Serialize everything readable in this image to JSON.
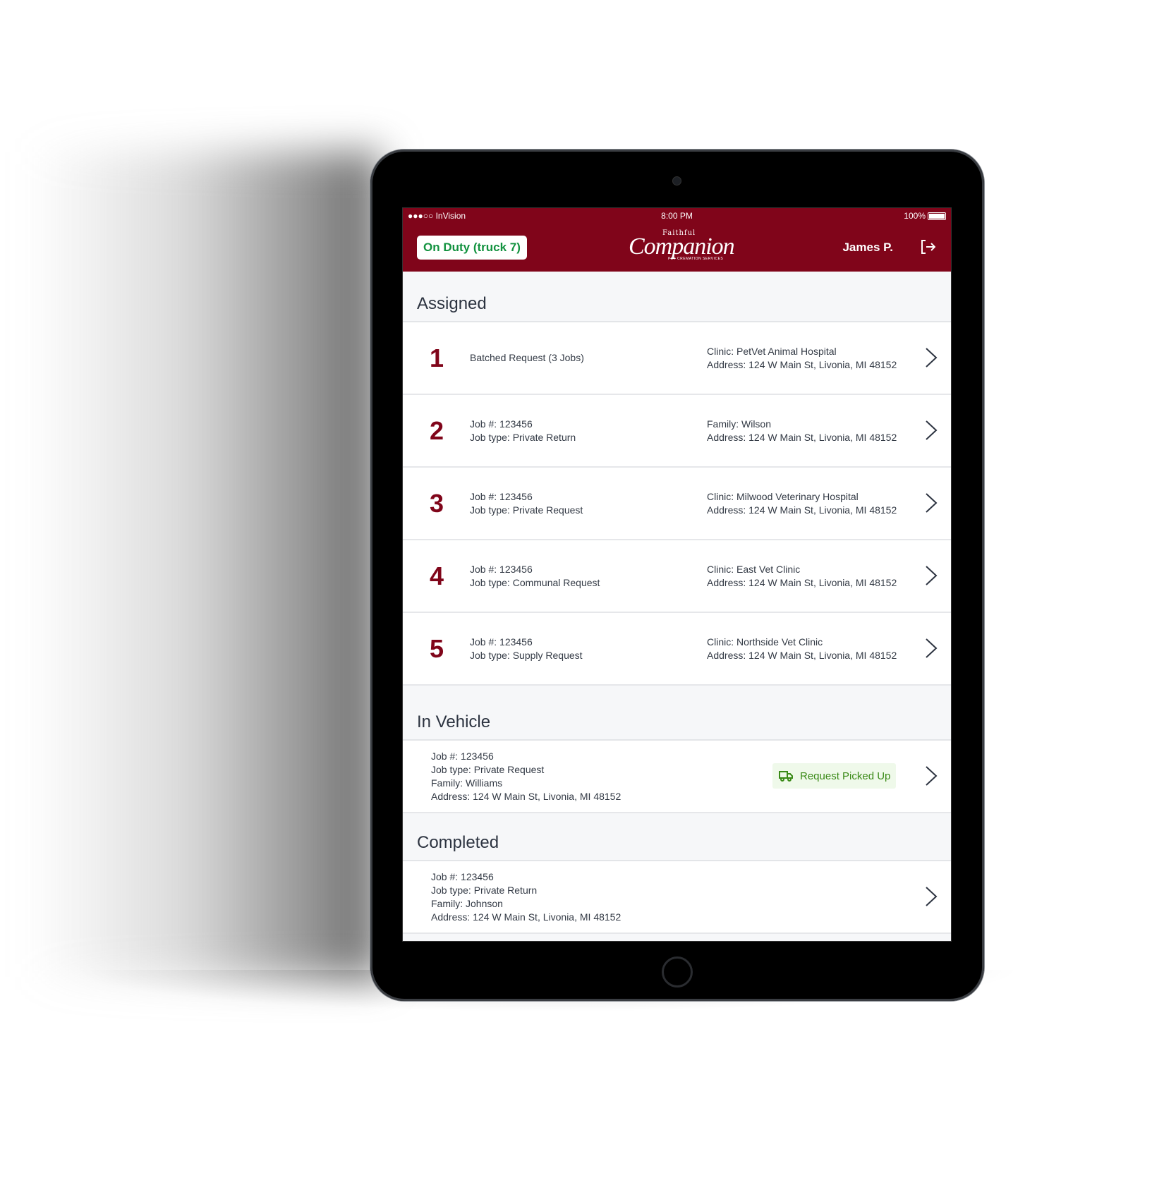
{
  "status_bar": {
    "carrier": "●●●○○ InVision",
    "time": "8:00 PM",
    "battery": "100%"
  },
  "header": {
    "duty_label": "On Duty (truck 7)",
    "logo": {
      "top": "Faithful",
      "main": "Companion",
      "sub": "PET CREMATION SERVICES"
    },
    "user_name": "James P.",
    "colors": {
      "brand": "#80051a",
      "duty_text": "#12923f"
    }
  },
  "sections": {
    "assigned": {
      "title": "Assigned",
      "items": [
        {
          "number": "1",
          "left": [
            "Batched Request (3 Jobs)"
          ],
          "right": [
            "Clinic: PetVet Animal Hospital",
            "Address: 124 W Main St, Livonia, MI 48152"
          ]
        },
        {
          "number": "2",
          "left": [
            "Job #: 123456",
            "Job type: Private Return"
          ],
          "right": [
            "Family: Wilson",
            "Address: 124 W Main St, Livonia, MI 48152"
          ]
        },
        {
          "number": "3",
          "left": [
            "Job #: 123456",
            "Job type: Private Request"
          ],
          "right": [
            "Clinic: Milwood Veterinary Hospital",
            "Address: 124 W Main St, Livonia, MI 48152"
          ]
        },
        {
          "number": "4",
          "left": [
            "Job #: 123456",
            "Job type: Communal Request"
          ],
          "right": [
            "Clinic: East Vet Clinic",
            "Address: 124 W Main St, Livonia, MI 48152"
          ]
        },
        {
          "number": "5",
          "left": [
            "Job #: 123456",
            "Job type: Supply Request"
          ],
          "right": [
            "Clinic: Northside Vet Clinic",
            "Address: 124 W Main St, Livonia, MI 48152"
          ]
        }
      ]
    },
    "in_vehicle": {
      "title": "In Vehicle",
      "items": [
        {
          "lines": [
            "Job #: 123456",
            "Job type: Private Request",
            "Family: Williams",
            "Address: 124 W Main St, Livonia, MI 48152"
          ],
          "action_label": "Request Picked Up",
          "action_icon": "truck-icon"
        }
      ]
    },
    "completed": {
      "title": "Completed",
      "items": [
        {
          "lines": [
            "Job #: 123456",
            "Job type: Private Return",
            "Family: Johnson",
            "Address: 124 W Main St, Livonia, MI 48152"
          ]
        }
      ]
    }
  }
}
